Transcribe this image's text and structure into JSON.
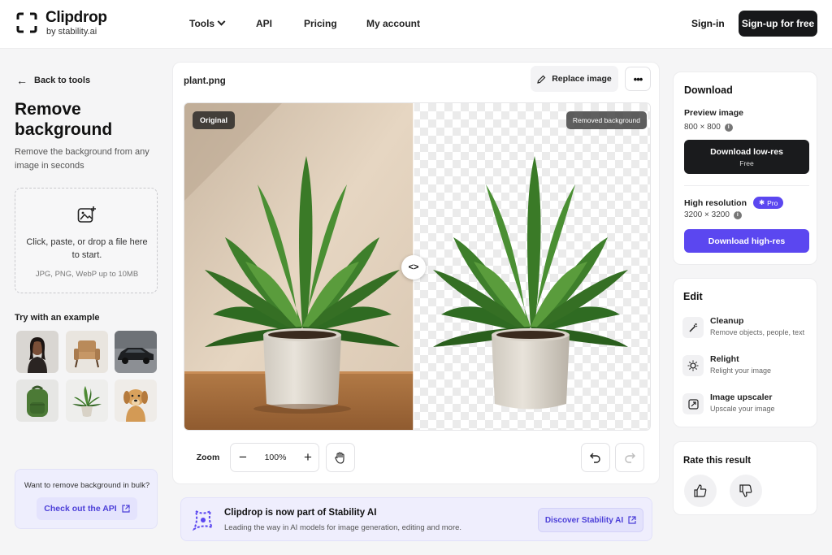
{
  "header": {
    "logo_name": "Clipdrop",
    "logo_sub": "by stability.ai",
    "nav": [
      "Tools",
      "API",
      "Pricing",
      "My account"
    ],
    "signin": "Sign-in",
    "signup": "Sign-up for free"
  },
  "left": {
    "back": "Back to tools",
    "title": "Remove background",
    "subtitle": "Remove the background from any image in seconds",
    "dropzone_text": "Click, paste, or drop a file here to start.",
    "dropzone_hint": "JPG, PNG, WebP up to 10MB",
    "try_label": "Try with an example",
    "examples": [
      "woman",
      "armchair",
      "car",
      "backpack",
      "plant",
      "dog"
    ],
    "bulk_text": "Want to remove background in bulk?",
    "bulk_button": "Check out the API"
  },
  "editor": {
    "filename": "plant.png",
    "replace_label": "Replace image",
    "more_label": "•••",
    "badge_original": "Original",
    "badge_removed": "Removed background",
    "handle_label": "<>",
    "zoom_label": "Zoom",
    "zoom_minus": "−",
    "zoom_plus": "+",
    "zoom_value": "100%"
  },
  "banner": {
    "title": "Clipdrop is now part of Stability AI",
    "subtitle": "Leading the way in AI models for image generation, editing and more.",
    "button": "Discover Stability AI"
  },
  "download": {
    "title": "Download",
    "preview_label": "Preview image",
    "preview_size": "800 × 800",
    "low_button": "Download low-res",
    "low_sub": "Free",
    "hr_label": "High resolution",
    "pro_badge": "Pro",
    "hr_size": "3200 × 3200",
    "high_button": "Download high-res",
    "info_glyph": "i"
  },
  "edit": {
    "title": "Edit",
    "items": [
      {
        "name": "Cleanup",
        "desc": "Remove objects, people, text",
        "icon": "wand-icon"
      },
      {
        "name": "Relight",
        "desc": "Relight your image",
        "icon": "sun-icon"
      },
      {
        "name": "Image upscaler",
        "desc": "Upscale your image",
        "icon": "upscale-icon"
      }
    ]
  },
  "rate": {
    "title": "Rate this result"
  },
  "colors": {
    "accent": "#5b47f0",
    "dark": "#17181a",
    "panel_bg": "#f5f5f6"
  }
}
